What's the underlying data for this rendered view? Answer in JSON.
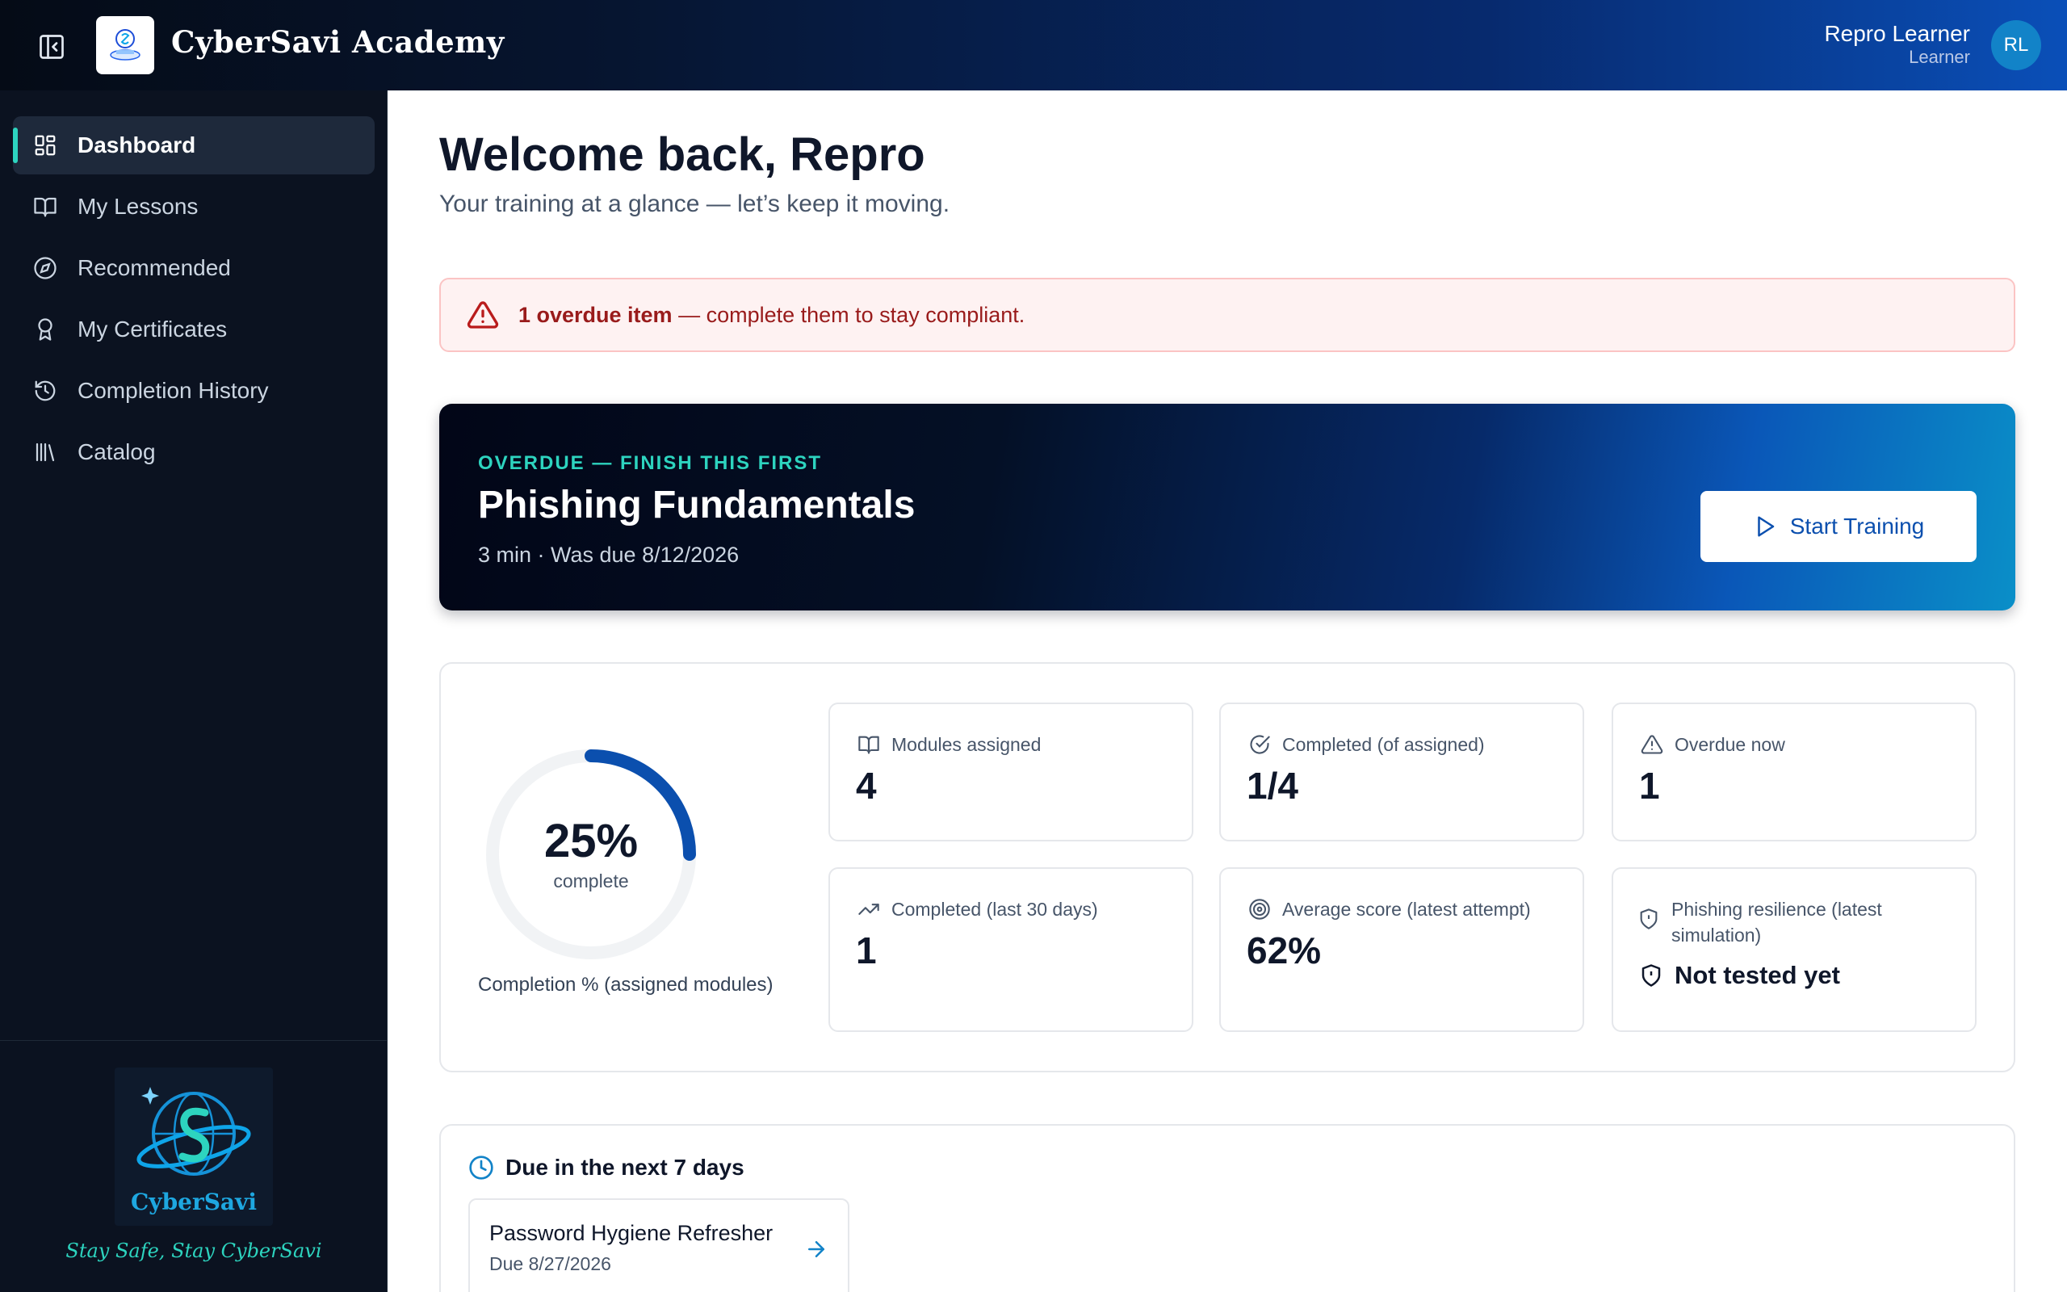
{
  "app": {
    "brand": "CyberSavi Academy",
    "user_name": "Repro Learner",
    "user_role": "Learner",
    "avatar_initials": "RL"
  },
  "sidebar": {
    "items": [
      {
        "label": "Dashboard",
        "icon": "dashboard-icon",
        "active": true
      },
      {
        "label": "My Lessons",
        "icon": "book-open-icon",
        "active": false
      },
      {
        "label": "Recommended",
        "icon": "compass-icon",
        "active": false
      },
      {
        "label": "My Certificates",
        "icon": "award-icon",
        "active": false
      },
      {
        "label": "Completion History",
        "icon": "history-icon",
        "active": false
      },
      {
        "label": "Catalog",
        "icon": "library-icon",
        "active": false
      }
    ],
    "footer_logo_text": "CyberSavi",
    "tagline": "Stay Safe, Stay CyberSavi"
  },
  "main": {
    "title": "Welcome back, Repro",
    "subtitle": "Your training at a glance — let’s keep it moving.",
    "alert": {
      "strong": "1 overdue item",
      "rest": " — complete them to stay compliant."
    },
    "hero": {
      "kicker": "OVERDUE — FINISH THIS FIRST",
      "title": "Phishing Fundamentals",
      "meta": "3 min · Was due 8/12/2026",
      "button": "Start Training"
    },
    "progress": {
      "percent_label": "25%",
      "percent_value": 0.25,
      "sub": "complete",
      "caption": "Completion % (assigned modules)"
    },
    "cards": [
      {
        "label": "Modules assigned",
        "value": "4",
        "icon": "book-icon"
      },
      {
        "label": "Completed (of assigned)",
        "value": "1/4",
        "icon": "check-circle-icon"
      },
      {
        "label": "Overdue now",
        "value": "1",
        "icon": "warning-icon"
      },
      {
        "label": "Completed (last 30 days)",
        "value": "1",
        "icon": "trending-up-icon"
      },
      {
        "label": "Average score (latest attempt)",
        "value": "62%",
        "icon": "target-icon"
      },
      {
        "label": "Phishing resilience (latest simulation)",
        "value": "Not tested yet",
        "icon": "shield-icon"
      }
    ],
    "due": {
      "heading": "Due in the next 7 days",
      "items": [
        {
          "title": "Password Hygiene Refresher",
          "due": "Due 8/27/2026"
        }
      ]
    }
  },
  "colors": {
    "accent": "#2dd4bf",
    "primary": "#0b4fae",
    "alert_text": "#991b1b",
    "ring": "#0b4fae"
  }
}
